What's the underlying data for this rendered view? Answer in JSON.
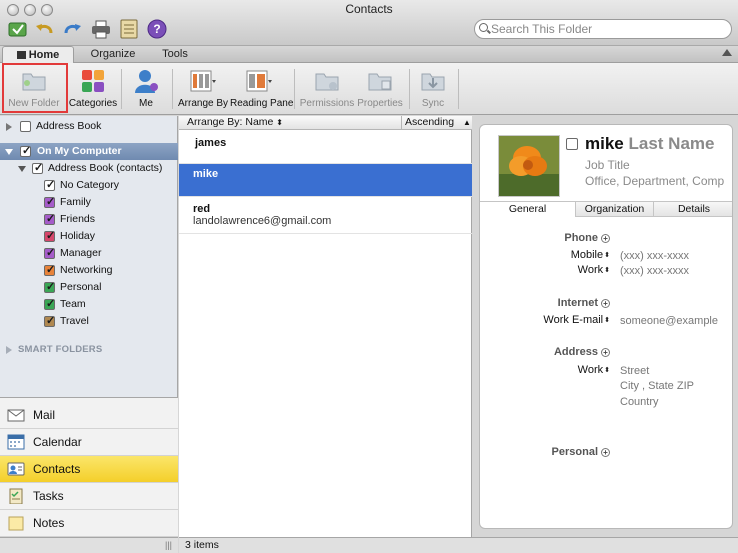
{
  "window": {
    "title": "Contacts"
  },
  "search": {
    "placeholder": "Search This Folder"
  },
  "tabs": [
    {
      "label": "Home"
    },
    {
      "label": "Organize"
    },
    {
      "label": "Tools"
    }
  ],
  "ribbon": {
    "new_folder": "New Folder",
    "categories": "Categories",
    "me": "Me",
    "arrange_by": "Arrange By",
    "reading_pane": "Reading Pane",
    "permissions": "Permissions",
    "properties": "Properties",
    "sync": "Sync"
  },
  "folders": {
    "address_book_top": "Address Book",
    "on_my_computer": "On My Computer",
    "address_book_contacts": "Address Book (contacts)",
    "categories": [
      {
        "label": "No Category",
        "color": "#ffffff"
      },
      {
        "label": "Family",
        "color": "#a55cc9"
      },
      {
        "label": "Friends",
        "color": "#a55cc9"
      },
      {
        "label": "Holiday",
        "color": "#d6466a"
      },
      {
        "label": "Manager",
        "color": "#a55cc9"
      },
      {
        "label": "Networking",
        "color": "#e8833a"
      },
      {
        "label": "Personal",
        "color": "#3aa655"
      },
      {
        "label": "Team",
        "color": "#3aa655"
      },
      {
        "label": "Travel",
        "color": "#b08850"
      }
    ],
    "smart_folders": "SMART FOLDERS"
  },
  "nav": [
    {
      "label": "Mail",
      "icon": "mail-icon"
    },
    {
      "label": "Calendar",
      "icon": "calendar-icon"
    },
    {
      "label": "Contacts",
      "icon": "contacts-icon"
    },
    {
      "label": "Tasks",
      "icon": "tasks-icon"
    },
    {
      "label": "Notes",
      "icon": "notes-icon"
    }
  ],
  "list": {
    "arrange_label": "Arrange By: Name",
    "sort_label": "Ascending",
    "items": [
      {
        "name": "james",
        "email": ""
      },
      {
        "name": "mike",
        "email": ""
      },
      {
        "name": "red",
        "email": "landolawrence6@gmail.com"
      }
    ]
  },
  "status": {
    "count": "3 items"
  },
  "contact": {
    "first_name": "mike",
    "last_name": "Last Name",
    "job_title": "Job Title",
    "org_line": "Office, Department, Comp",
    "tabs": [
      "General",
      "Organization",
      "Details"
    ],
    "phone_section": "Phone",
    "mobile_label": "Mobile",
    "mobile_value": "(xxx) xxx-xxxx",
    "work_label": "Work",
    "work_value": "(xxx) xxx-xxxx",
    "internet_section": "Internet",
    "email_label": "Work E-mail",
    "email_value": "someone@example",
    "address_section": "Address",
    "address_label": "Work",
    "street": "Street",
    "city_line": "City , State ZIP",
    "country": "Country",
    "personal_section": "Personal"
  },
  "colors": {
    "accent_selection": "#3a6fd1",
    "nav_active": "#f4cf2a",
    "highlight_box": "#e23a3a"
  }
}
